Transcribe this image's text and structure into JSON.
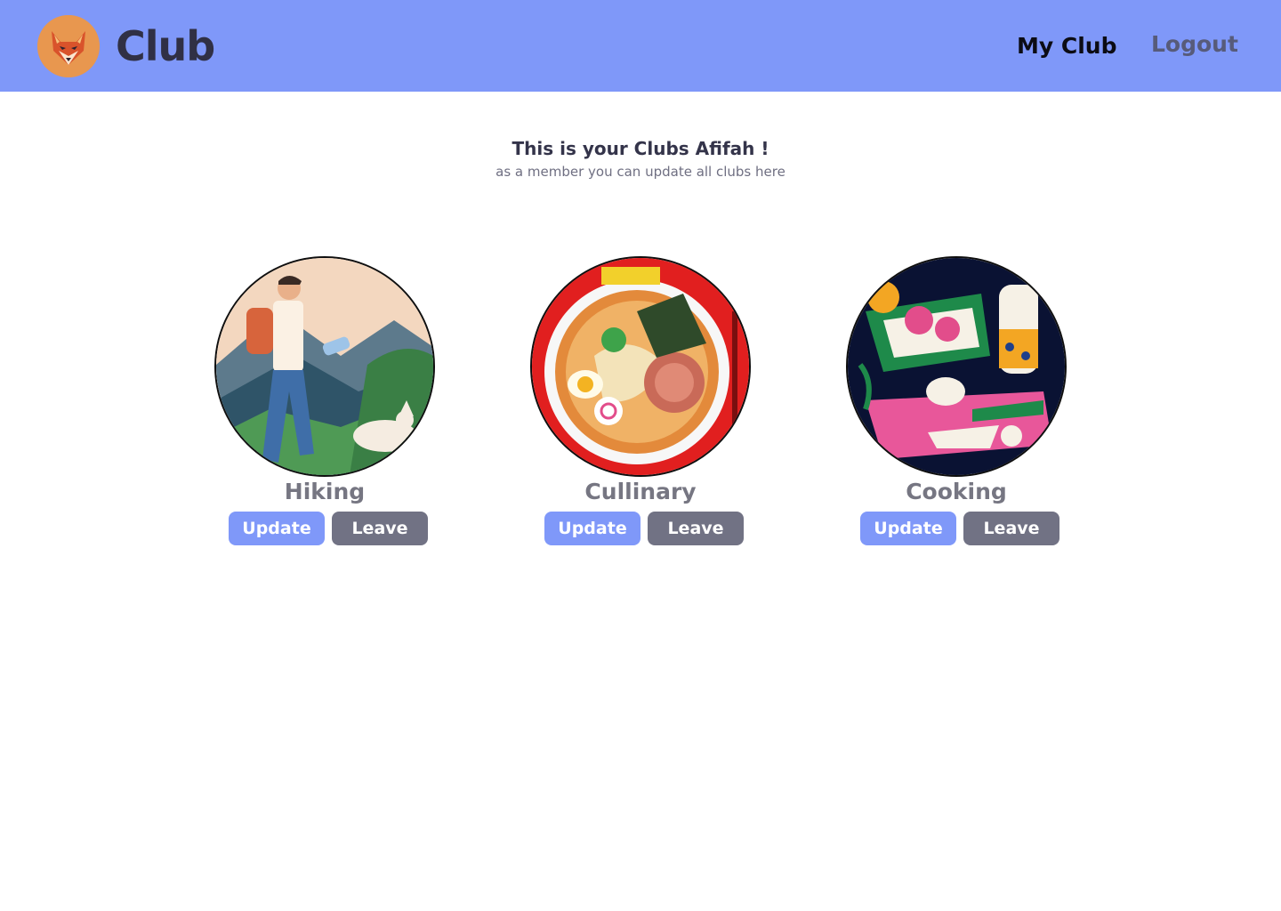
{
  "nav": {
    "brand": "Club",
    "logo_icon": "fox-logo-icon",
    "links": {
      "my_club": "My Club",
      "logout": "Logout"
    }
  },
  "header": {
    "title": "This is your Clubs Afifah !",
    "subtitle": "as a member you can update all clubs here"
  },
  "clubs": [
    {
      "name": "Hiking",
      "image": "hiking-illustration",
      "update_label": "Update",
      "leave_label": "Leave"
    },
    {
      "name": "Cullinary",
      "image": "ramen-bowl-illustration",
      "update_label": "Update",
      "leave_label": "Leave"
    },
    {
      "name": "Cooking",
      "image": "cooking-ingredients-illustration",
      "update_label": "Update",
      "leave_label": "Leave"
    }
  ],
  "colors": {
    "navbar": "#7f98f9",
    "update_button": "#7f98f9",
    "leave_button": "#717284",
    "club_name": "#767682"
  }
}
